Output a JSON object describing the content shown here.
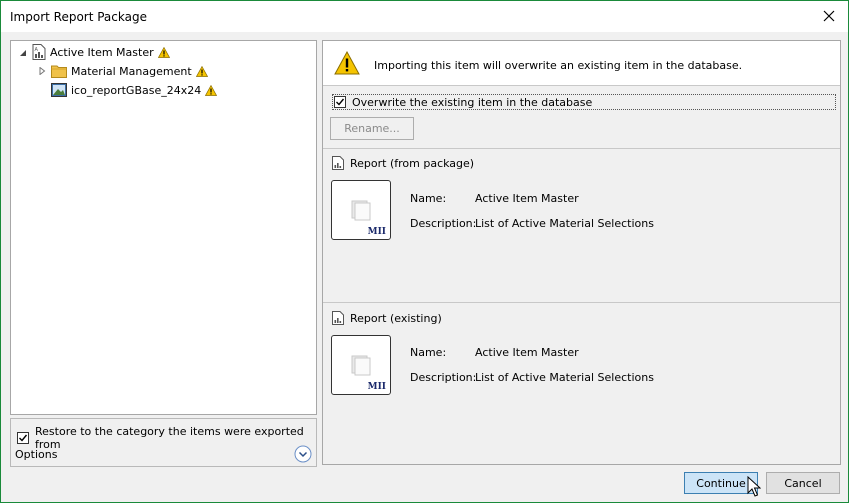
{
  "window": {
    "title": "Import Report Package"
  },
  "tree": {
    "items": [
      {
        "label": "Active Item Master",
        "expanded": true,
        "warning": true
      },
      {
        "label": "Material Management",
        "expanded": false,
        "warning": true
      },
      {
        "label": "ico_reportGBase_24x24",
        "warning": true
      }
    ]
  },
  "options": {
    "restore_label": "Restore to the category the items were exported from",
    "restore_checked": true,
    "options_label": "Options"
  },
  "warning": {
    "message": "Importing this item will overwrite an existing item in the database."
  },
  "overwrite": {
    "label": "Overwrite the existing item in the database",
    "checked": true
  },
  "rename_label": "Rename...",
  "package_report": {
    "header": "Report (from package)",
    "name_label": "Name:",
    "name_value": "Active Item Master",
    "description_label": "Description:",
    "description_value": "List of Active Material Selections",
    "thumb_badge": "MII"
  },
  "existing_report": {
    "header": "Report (existing)",
    "name_label": "Name:",
    "name_value": "Active Item Master",
    "description_label": "Description:",
    "description_value": "List of Active Material Selections",
    "thumb_badge": "MII"
  },
  "buttons": {
    "continue": "Continue",
    "cancel": "Cancel"
  },
  "colors": {
    "border_accent": "#1a8a3a",
    "continue_bg": "#cce4f7",
    "warning_yellow": "#f5c400"
  }
}
